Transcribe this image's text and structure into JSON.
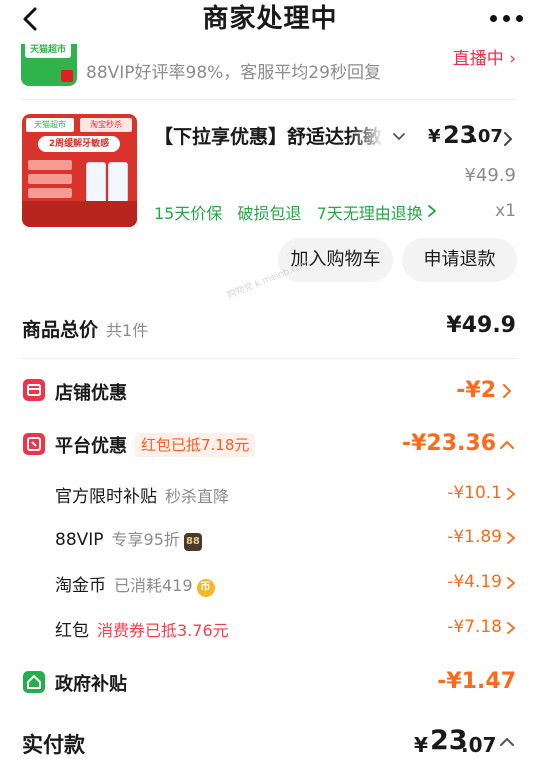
{
  "header": {
    "title": "商家处理中"
  },
  "store": {
    "logo_tag": "天猫超市",
    "meta": "88VIP好评率98%，客服平均29秒回复",
    "live_link": "直播中"
  },
  "product": {
    "image_badge_1": "天猫超市",
    "image_badge_2": "淘宝秒杀",
    "image_headline": "2周缓解牙敏感",
    "title": "【下拉享优惠】舒适达抗敏",
    "price_currency": "¥",
    "price_int": "23",
    "price_dec": ".07",
    "original_price": "¥49.9",
    "guarantees": [
      "15天价保",
      "破损包退",
      "7天无理由退换"
    ],
    "quantity": "x1",
    "buttons": {
      "add_to_cart": "加入购物车",
      "request_refund": "申请退款"
    }
  },
  "watermark": "购物党 k.meinb.com",
  "summary": {
    "goods_total_label": "商品总价",
    "goods_total_count": "共1件",
    "goods_total_value": "¥49.9",
    "shop_discount_label": "店铺优惠",
    "shop_discount_value": "-¥2",
    "platform_discount_label": "平台优惠",
    "platform_discount_pill": "红包已抵7.18元",
    "platform_discount_value": "-¥23.36",
    "items": [
      {
        "label": "官方限时补贴",
        "note": "秒杀直降",
        "value": "-¥10.1"
      },
      {
        "label": "88VIP",
        "note": "专享95折",
        "badge": "88",
        "value": "-¥1.89"
      },
      {
        "label": "淘金币",
        "note": "已消耗419",
        "badge": "币",
        "value": "-¥4.19"
      },
      {
        "label": "红包",
        "note": "消费券已抵3.76元",
        "value": "-¥7.18"
      }
    ],
    "gov_subsidy_label": "政府补贴",
    "gov_subsidy_value": "-¥1.47",
    "actual_pay_label": "实付款",
    "actual_pay_currency": "¥",
    "actual_pay_int": "23",
    "actual_pay_dec": ".07"
  },
  "colors": {
    "accent_orange": "#ff6a1a",
    "accent_red": "#f1334a",
    "accent_green": "#23b04a",
    "muted_text": "#8c8c8c"
  }
}
